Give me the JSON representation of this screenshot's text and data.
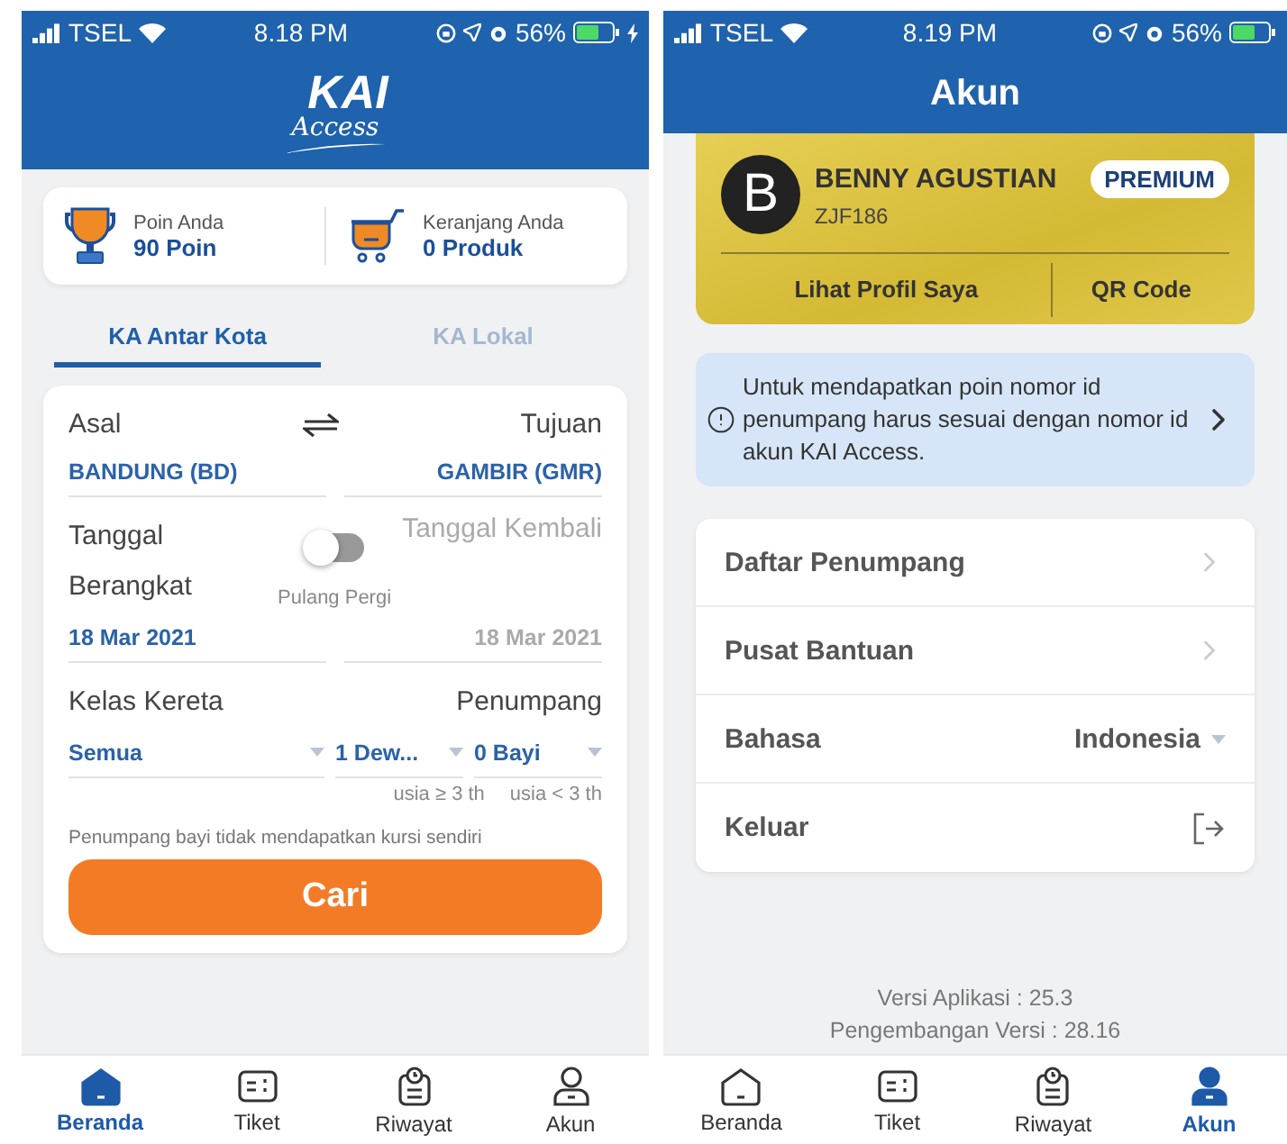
{
  "home_screen": {
    "status_bar": {
      "carrier": "TSEL",
      "time": "8.18 PM",
      "battery": "56%",
      "charging": true
    },
    "logo": {
      "title": "KAI",
      "subtitle": "Access"
    },
    "summary": [
      {
        "kind": "trophy",
        "label": "Poin Anda",
        "value": "90 Poin"
      },
      {
        "kind": "cart",
        "label": "Keranjang Anda",
        "value": "0 Produk"
      }
    ],
    "tabs": [
      {
        "label": "KA Antar Kota",
        "selected": true
      },
      {
        "label": "KA Lokal",
        "selected": false
      }
    ],
    "form": {
      "origin": {
        "label": "Asal",
        "value": "BANDUNG (BD)"
      },
      "destination": {
        "label": "Tujuan",
        "value": "GAMBIR (GMR)"
      },
      "departure": {
        "label": "Tanggal Berangkat",
        "value": "18 Mar 2021"
      },
      "round_trip": {
        "label": "Pulang Pergi",
        "on": false
      },
      "return": {
        "label": "Tanggal Kembali",
        "value": "18 Mar 2021"
      },
      "train_class": {
        "label": "Kelas Kereta",
        "value": "Semua"
      },
      "passengers": {
        "label": "Penumpang",
        "adult": {
          "value": "1 Dew...",
          "hint": "usia ≥ 3 th"
        },
        "infant": {
          "value": "0 Bayi",
          "hint": "usia < 3 th"
        }
      },
      "note": "Penumpang bayi tidak mendapatkan kursi sendiri",
      "submit": "Cari"
    },
    "bottom_nav": [
      {
        "kind": "home",
        "label": "Beranda",
        "selected": true
      },
      {
        "kind": "ticket",
        "label": "Tiket",
        "selected": false
      },
      {
        "kind": "history",
        "label": "Riwayat",
        "selected": false
      },
      {
        "kind": "account",
        "label": "Akun",
        "selected": false
      }
    ]
  },
  "account_screen": {
    "status_bar": {
      "carrier": "TSEL",
      "time": "8.19 PM",
      "battery": "56%",
      "charging": false
    },
    "title": "Akun",
    "profile": {
      "initial": "B",
      "name": "BENNY AGUSTIAN",
      "badge": "PREMIUM",
      "id": "ZJF186",
      "actions": [
        "Lihat Profil Saya",
        "QR Code"
      ]
    },
    "notice": "Untuk mendapatkan poin nomor id penumpang harus sesuai dengan nomor id akun KAI Access.",
    "menu": [
      {
        "kind": "link",
        "label": "Daftar Penumpang"
      },
      {
        "kind": "link",
        "label": "Pusat Bantuan"
      },
      {
        "kind": "select",
        "label": "Bahasa",
        "value": "Indonesia"
      },
      {
        "kind": "logout",
        "label": "Keluar"
      }
    ],
    "version": [
      "Versi Aplikasi : 25.3",
      "Pengembangan Versi : 28.16"
    ],
    "bottom_nav": [
      {
        "kind": "home",
        "label": "Beranda",
        "selected": false
      },
      {
        "kind": "ticket",
        "label": "Tiket",
        "selected": false
      },
      {
        "kind": "history",
        "label": "Riwayat",
        "selected": false
      },
      {
        "kind": "account",
        "label": "Akun",
        "selected": true
      }
    ]
  }
}
